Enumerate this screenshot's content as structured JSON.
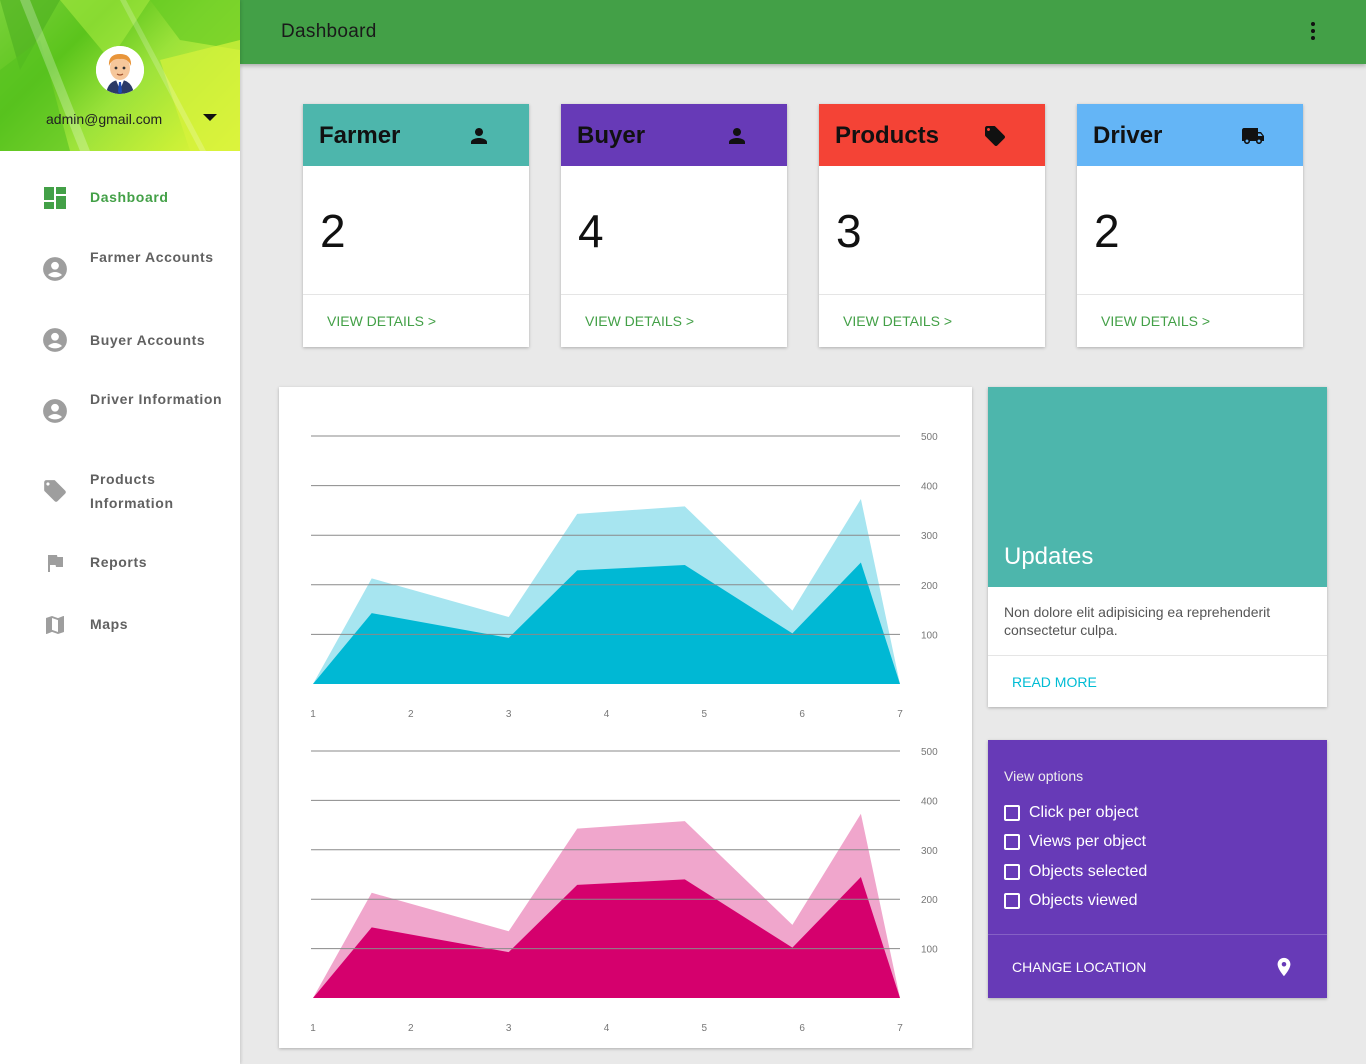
{
  "user": {
    "email": "admin@gmail.com"
  },
  "sidebar": {
    "items": [
      {
        "label": "Dashboard",
        "icon": "dashboard-icon",
        "active": true
      },
      {
        "label": "Farmer Accounts",
        "icon": "account-circle-icon"
      },
      {
        "label": "Buyer Accounts",
        "icon": "account-circle-icon"
      },
      {
        "label": "Driver Information",
        "icon": "account-circle-icon"
      },
      {
        "label": "Products Information",
        "icon": "tag-icon"
      },
      {
        "label": "Reports",
        "icon": "flag-icon"
      },
      {
        "label": "Maps",
        "icon": "map-icon"
      }
    ]
  },
  "header": {
    "title": "Dashboard",
    "menu_icon": "more-vert-icon"
  },
  "cards": [
    {
      "title": "Farmer",
      "value": "2",
      "link": "VIEW DETAILS >",
      "color": "#4db6ac",
      "icon": "person-icon"
    },
    {
      "title": "Buyer",
      "value": "4",
      "link": "VIEW DETAILS >",
      "color": "#673ab7",
      "icon": "person-icon"
    },
    {
      "title": "Products",
      "value": "3",
      "link": "VIEW DETAILS >",
      "color": "#f44336",
      "icon": "tag-icon"
    },
    {
      "title": "Driver",
      "value": "2",
      "link": "VIEW DETAILS >",
      "color": "#64b5f6",
      "icon": "truck-icon"
    }
  ],
  "chart_data": [
    {
      "type": "area",
      "x": [
        "1",
        "2",
        "3",
        "4",
        "5",
        "6",
        "7"
      ],
      "x_positions": [
        1,
        1.6,
        3,
        3.7,
        4.8,
        5.9,
        6.6,
        7
      ],
      "series": [
        {
          "values": [
            0,
            213,
            135,
            343,
            358,
            148,
            373,
            0
          ],
          "color": "#a7e5f0"
        },
        {
          "values": [
            0,
            143,
            93,
            229,
            240,
            102,
            245,
            0
          ],
          "color": "#00b8d4"
        }
      ],
      "yticks": [
        100,
        200,
        300,
        400,
        500
      ],
      "ylim": [
        0,
        500
      ]
    },
    {
      "type": "area",
      "x": [
        "1",
        "2",
        "3",
        "4",
        "5",
        "6",
        "7"
      ],
      "x_positions": [
        1,
        1.6,
        3,
        3.7,
        4.8,
        5.9,
        6.6,
        7
      ],
      "series": [
        {
          "values": [
            0,
            213,
            135,
            343,
            358,
            148,
            373,
            0
          ],
          "color": "#f0a6cc"
        },
        {
          "values": [
            0,
            143,
            93,
            229,
            240,
            102,
            245,
            0
          ],
          "color": "#d5006d"
        }
      ],
      "yticks": [
        100,
        200,
        300,
        400,
        500
      ],
      "ylim": [
        0,
        500
      ]
    }
  ],
  "updates": {
    "title": "Updates",
    "text": "Non dolore elit adipisicing ea reprehenderit consectetur culpa.",
    "link": "READ MORE",
    "color": "#4db6ac"
  },
  "view_options": {
    "title": "View options",
    "options": [
      "Click per object",
      "Views per object",
      "Objects selected",
      "Objects viewed"
    ],
    "link": "CHANGE LOCATION",
    "color": "#673ab7"
  }
}
